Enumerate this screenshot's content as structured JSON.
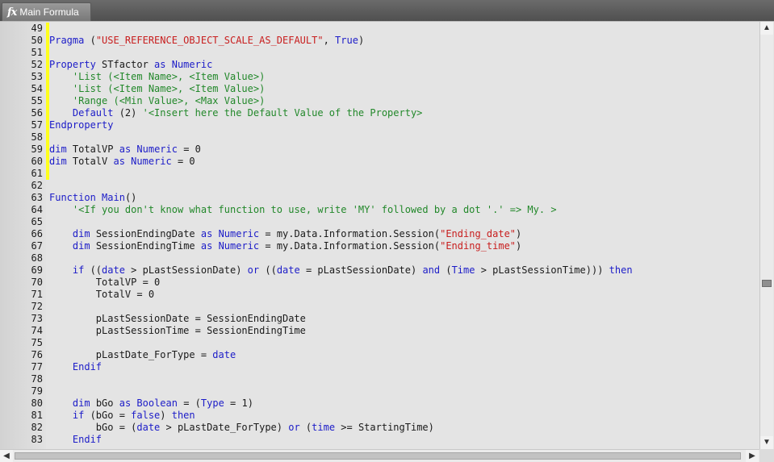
{
  "tab": {
    "icon": "formula-icon",
    "icon_glyph": "fx",
    "label": "Main Formula"
  },
  "colors": {
    "keyword": "#1c1cc8",
    "string": "#c81e1e",
    "comment": "#22882a",
    "text": "#1a1a1a",
    "change_marker": "#ffff1e"
  },
  "lines": [
    {
      "n": "49",
      "marked": true,
      "tokens": []
    },
    {
      "n": "50",
      "marked": true,
      "tokens": [
        [
          "kw",
          "Pragma"
        ],
        [
          "t",
          " ("
        ],
        [
          "str",
          "\"USE_REFERENCE_OBJECT_SCALE_AS_DEFAULT\""
        ],
        [
          "t",
          ", "
        ],
        [
          "kw",
          "True"
        ],
        [
          "t",
          ")"
        ]
      ]
    },
    {
      "n": "51",
      "marked": true,
      "tokens": []
    },
    {
      "n": "52",
      "marked": true,
      "tokens": [
        [
          "kw",
          "Property"
        ],
        [
          "t",
          " STfactor "
        ],
        [
          "kw",
          "as"
        ],
        [
          "t",
          " "
        ],
        [
          "kw",
          "Numeric"
        ]
      ]
    },
    {
      "n": "53",
      "marked": true,
      "tokens": [
        [
          "t",
          "    "
        ],
        [
          "cmt",
          "'List (<Item Name>, <Item Value>)"
        ]
      ]
    },
    {
      "n": "54",
      "marked": true,
      "tokens": [
        [
          "t",
          "    "
        ],
        [
          "cmt",
          "'List (<Item Name>, <Item Value>)"
        ]
      ]
    },
    {
      "n": "55",
      "marked": true,
      "tokens": [
        [
          "t",
          "    "
        ],
        [
          "cmt",
          "'Range (<Min Value>, <Max Value>)"
        ]
      ]
    },
    {
      "n": "56",
      "marked": true,
      "tokens": [
        [
          "t",
          "    "
        ],
        [
          "kw",
          "Default"
        ],
        [
          "t",
          " (2) "
        ],
        [
          "cmt",
          "'<Insert here the Default Value of the Property>"
        ]
      ]
    },
    {
      "n": "57",
      "marked": true,
      "tokens": [
        [
          "kw",
          "Endproperty"
        ]
      ]
    },
    {
      "n": "58",
      "marked": true,
      "tokens": []
    },
    {
      "n": "59",
      "marked": true,
      "tokens": [
        [
          "kw",
          "dim"
        ],
        [
          "t",
          " TotalVP "
        ],
        [
          "kw",
          "as"
        ],
        [
          "t",
          " "
        ],
        [
          "kw",
          "Numeric"
        ],
        [
          "t",
          " = 0"
        ]
      ]
    },
    {
      "n": "60",
      "marked": true,
      "tokens": [
        [
          "kw",
          "dim"
        ],
        [
          "t",
          " TotalV "
        ],
        [
          "kw",
          "as"
        ],
        [
          "t",
          " "
        ],
        [
          "kw",
          "Numeric"
        ],
        [
          "t",
          " = 0"
        ]
      ]
    },
    {
      "n": "61",
      "marked": true,
      "tokens": []
    },
    {
      "n": "62",
      "marked": false,
      "tokens": []
    },
    {
      "n": "63",
      "marked": false,
      "tokens": [
        [
          "kw",
          "Function"
        ],
        [
          "t",
          " "
        ],
        [
          "kw",
          "Main"
        ],
        [
          "t",
          "()"
        ]
      ]
    },
    {
      "n": "64",
      "marked": false,
      "tokens": [
        [
          "t",
          "    "
        ],
        [
          "cmt",
          "'<If you don't know what function to use, write 'MY' followed by a dot '.' => My. >"
        ]
      ]
    },
    {
      "n": "65",
      "marked": false,
      "tokens": []
    },
    {
      "n": "66",
      "marked": false,
      "tokens": [
        [
          "t",
          "    "
        ],
        [
          "kw",
          "dim"
        ],
        [
          "t",
          " SessionEndingDate "
        ],
        [
          "kw",
          "as"
        ],
        [
          "t",
          " "
        ],
        [
          "kw",
          "Numeric"
        ],
        [
          "t",
          " = my.Data.Information.Session("
        ],
        [
          "str",
          "\"Ending_date\""
        ],
        [
          "t",
          ")"
        ]
      ]
    },
    {
      "n": "67",
      "marked": false,
      "tokens": [
        [
          "t",
          "    "
        ],
        [
          "kw",
          "dim"
        ],
        [
          "t",
          " SessionEndingTime "
        ],
        [
          "kw",
          "as"
        ],
        [
          "t",
          " "
        ],
        [
          "kw",
          "Numeric"
        ],
        [
          "t",
          " = my.Data.Information.Session("
        ],
        [
          "str",
          "\"Ending_time\""
        ],
        [
          "t",
          ")"
        ]
      ]
    },
    {
      "n": "68",
      "marked": false,
      "tokens": []
    },
    {
      "n": "69",
      "marked": false,
      "tokens": [
        [
          "t",
          "    "
        ],
        [
          "kw",
          "if"
        ],
        [
          "t",
          " (("
        ],
        [
          "kw",
          "date"
        ],
        [
          "t",
          " > pLastSessionDate) "
        ],
        [
          "kw",
          "or"
        ],
        [
          "t",
          " (("
        ],
        [
          "kw",
          "date"
        ],
        [
          "t",
          " = pLastSessionDate) "
        ],
        [
          "kw",
          "and"
        ],
        [
          "t",
          " ("
        ],
        [
          "kw",
          "Time"
        ],
        [
          "t",
          " > pLastSessionTime))) "
        ],
        [
          "kw",
          "then"
        ]
      ]
    },
    {
      "n": "70",
      "marked": false,
      "tokens": [
        [
          "t",
          "        TotalVP = 0"
        ]
      ]
    },
    {
      "n": "71",
      "marked": false,
      "tokens": [
        [
          "t",
          "        TotalV = 0"
        ]
      ]
    },
    {
      "n": "72",
      "marked": false,
      "tokens": []
    },
    {
      "n": "73",
      "marked": false,
      "tokens": [
        [
          "t",
          "        pLastSessionDate = SessionEndingDate"
        ]
      ]
    },
    {
      "n": "74",
      "marked": false,
      "tokens": [
        [
          "t",
          "        pLastSessionTime = SessionEndingTime"
        ]
      ]
    },
    {
      "n": "75",
      "marked": false,
      "tokens": []
    },
    {
      "n": "76",
      "marked": false,
      "tokens": [
        [
          "t",
          "        pLastDate_ForType = "
        ],
        [
          "kw",
          "date"
        ]
      ]
    },
    {
      "n": "77",
      "marked": false,
      "tokens": [
        [
          "t",
          "    "
        ],
        [
          "kw",
          "Endif"
        ]
      ]
    },
    {
      "n": "78",
      "marked": false,
      "tokens": []
    },
    {
      "n": "79",
      "marked": false,
      "tokens": []
    },
    {
      "n": "80",
      "marked": false,
      "tokens": [
        [
          "t",
          "    "
        ],
        [
          "kw",
          "dim"
        ],
        [
          "t",
          " bGo "
        ],
        [
          "kw",
          "as"
        ],
        [
          "t",
          " "
        ],
        [
          "kw",
          "Boolean"
        ],
        [
          "t",
          " = ("
        ],
        [
          "kw",
          "Type"
        ],
        [
          "t",
          " = 1)"
        ]
      ]
    },
    {
      "n": "81",
      "marked": false,
      "tokens": [
        [
          "t",
          "    "
        ],
        [
          "kw",
          "if"
        ],
        [
          "t",
          " (bGo = "
        ],
        [
          "kw",
          "false"
        ],
        [
          "t",
          ") "
        ],
        [
          "kw",
          "then"
        ]
      ]
    },
    {
      "n": "82",
      "marked": false,
      "tokens": [
        [
          "t",
          "        bGo = ("
        ],
        [
          "kw",
          "date"
        ],
        [
          "t",
          " > pLastDate_ForType) "
        ],
        [
          "kw",
          "or"
        ],
        [
          "t",
          " ("
        ],
        [
          "kw",
          "time"
        ],
        [
          "t",
          " >= StartingTime)"
        ]
      ]
    },
    {
      "n": "83",
      "marked": false,
      "tokens": [
        [
          "t",
          "    "
        ],
        [
          "kw",
          "Endif"
        ]
      ]
    }
  ],
  "scrollbar": {
    "up_icon": "arrow-up-icon",
    "down_icon": "arrow-down-icon",
    "left_icon": "arrow-left-icon",
    "right_icon": "arrow-right-icon"
  }
}
